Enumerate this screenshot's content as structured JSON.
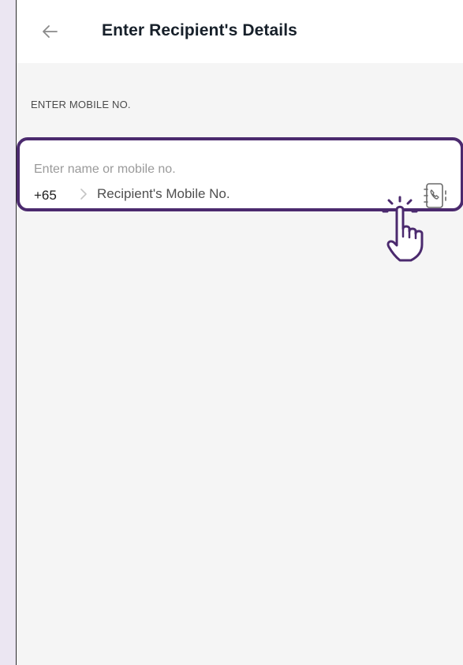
{
  "header": {
    "title": "Enter Recipient's Details",
    "back_icon": "arrow-left-icon"
  },
  "section": {
    "label": "ENTER MOBILE NO."
  },
  "recipient_input": {
    "hint": "Enter name or mobile no.",
    "country_code": "+65",
    "placeholder": "Recipient's Mobile No.",
    "value": "",
    "chevron_icon": "chevron-right-icon",
    "contacts_icon": "contact-book-phone-icon"
  },
  "overlay": {
    "tap_hint_icon": "tap-hand-icon"
  },
  "colors": {
    "page_background": "#ebe6f2",
    "screen_background": "#f5f5f5",
    "accent_border": "#4b2a6e",
    "title_text": "#17202a"
  }
}
